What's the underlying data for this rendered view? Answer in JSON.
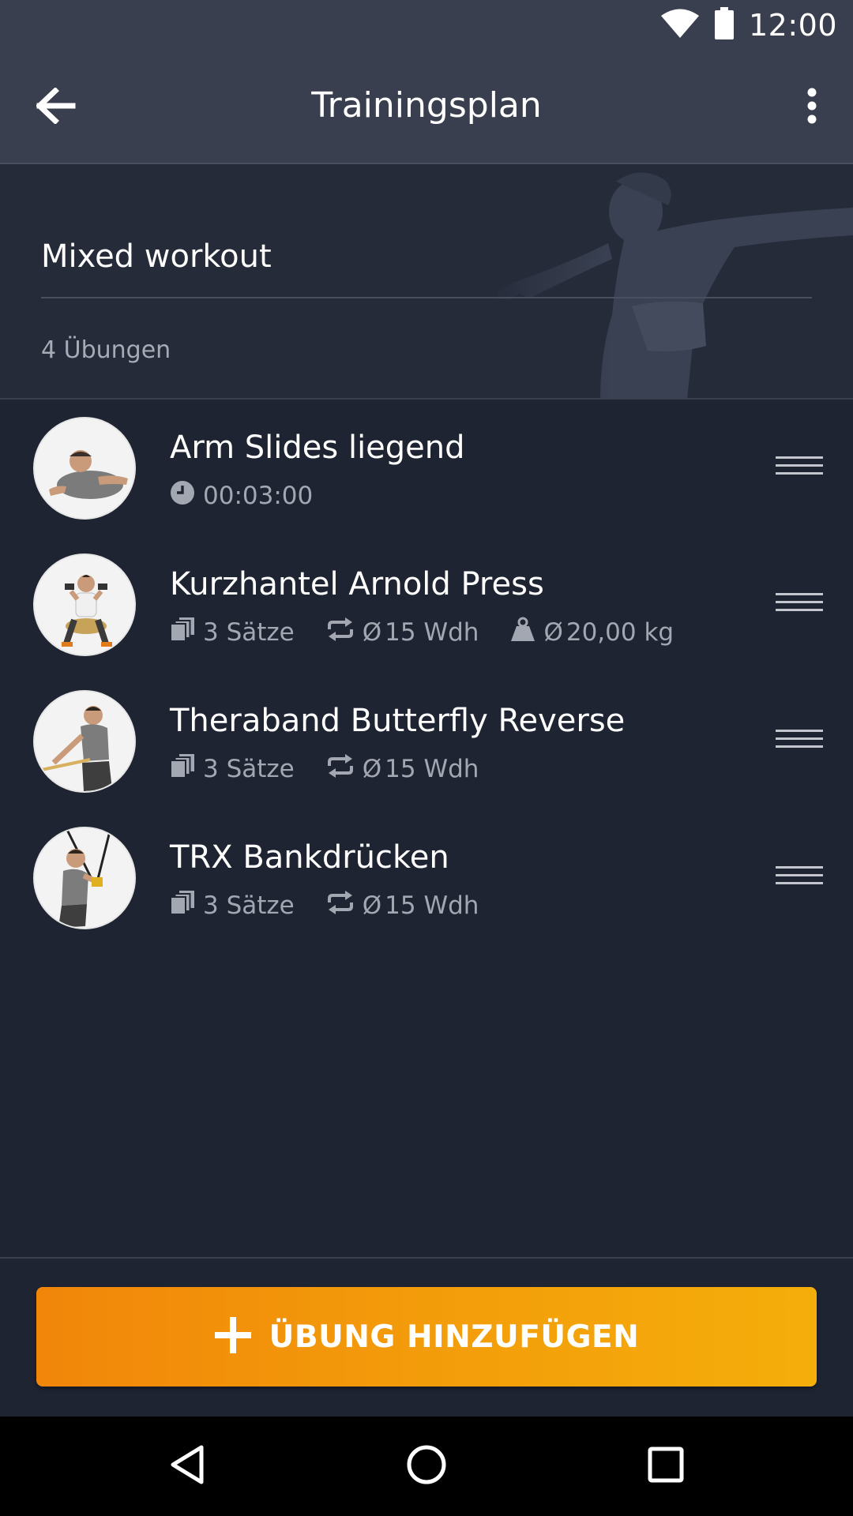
{
  "status_bar": {
    "time": "12:00",
    "icons": [
      "wifi-icon",
      "battery-icon"
    ]
  },
  "app_bar": {
    "title": "Trainingsplan",
    "back_icon": "arrow-left-icon",
    "menu_icon": "more-vertical-icon"
  },
  "plan": {
    "name": "Mixed workout",
    "exercise_count": "4 Übungen"
  },
  "exercises": [
    {
      "name": "Arm Slides liegend",
      "duration": "00:03:00"
    },
    {
      "name": "Kurzhantel Arnold Press",
      "sets": "3 Sätze",
      "reps": "15 Wdh",
      "weight": "20,00 kg"
    },
    {
      "name": "Theraband Butterfly Reverse",
      "sets": "3 Sätze",
      "reps": "15 Wdh"
    },
    {
      "name": "TRX Bankdrücken",
      "sets": "3 Sätze",
      "reps": "15 Wdh"
    }
  ],
  "meta_symbols": {
    "average": "Ø"
  },
  "add_button": {
    "label": "ÜBUNG HINZUFÜGEN"
  },
  "colors": {
    "background": "#1f2433",
    "app_bar": "#3a3f4f",
    "accent_start": "#f1860a",
    "accent_end": "#f4ae0a",
    "meta_text": "#a3a7b2"
  }
}
